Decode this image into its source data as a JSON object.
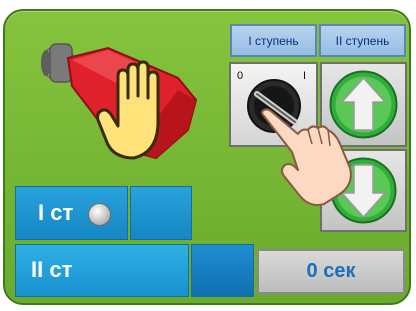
{
  "stages": {
    "stage1_label": "I ступень",
    "stage2_label": "II ступень"
  },
  "selector": {
    "position_0": "0",
    "position_1": "I"
  },
  "status": {
    "row1_label": "I ст",
    "row2_label": "II ст",
    "row1_lamp": "off",
    "timer": "0 сек"
  },
  "colors": {
    "frame_green": "#76b634",
    "panel_blue": "#1f94cf",
    "burner_red": "#e0202a",
    "hand_yellow": "#ffe27a",
    "arrow_green": "#2fae3b"
  },
  "icons": {
    "manual_mode": "hand-stop-icon",
    "selector": "rotary-switch-icon",
    "pointer": "pointing-hand-icon",
    "up": "arrow-up-icon",
    "down": "arrow-down-icon"
  }
}
